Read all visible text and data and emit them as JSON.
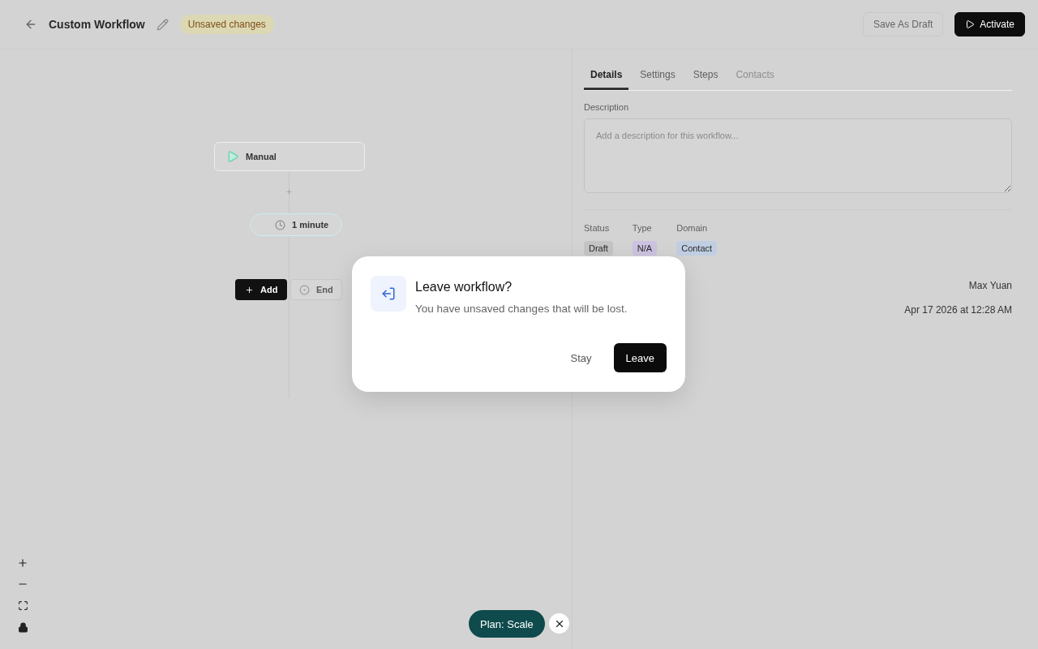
{
  "header": {
    "title": "Custom Workflow",
    "status_badge": "Unsaved changes",
    "buttons": [
      {
        "label": "Save As Draft",
        "kind": "secondary"
      },
      {
        "label": "Activate",
        "kind": "primary"
      }
    ]
  },
  "canvas": {
    "trigger": {
      "label": "Manual"
    },
    "delay": {
      "label": "1 minute"
    },
    "add_button": {
      "label": "Add"
    },
    "end_node": {
      "label": "End"
    }
  },
  "panel": {
    "tabs": [
      {
        "label": "Details",
        "selected": true,
        "disabled": false
      },
      {
        "label": "Settings",
        "selected": false,
        "disabled": false
      },
      {
        "label": "Steps",
        "selected": false,
        "disabled": false
      },
      {
        "label": "Contacts",
        "selected": false,
        "disabled": true
      }
    ],
    "description": {
      "label": "Description",
      "placeholder": "Add a description for this workflow..."
    },
    "tags": [
      {
        "label": "Status",
        "value": "Draft",
        "color": "#c4c4c4"
      },
      {
        "label": "Type",
        "value": "N/A",
        "color": "#cbc3e0"
      },
      {
        "label": "Domain",
        "value": "Contact",
        "color": "#c0cee2"
      }
    ],
    "details": [
      "Max Yuan",
      "Apr 17 2026 at 12:28 AM"
    ]
  },
  "dialog": {
    "title": "Leave workflow?",
    "message": "You have unsaved changes that will be lost.",
    "buttons": [
      {
        "label": "Stay",
        "kind": "secondary"
      },
      {
        "label": "Leave",
        "kind": "primary"
      }
    ]
  },
  "plan_pill": {
    "label": "Plan: Scale"
  }
}
